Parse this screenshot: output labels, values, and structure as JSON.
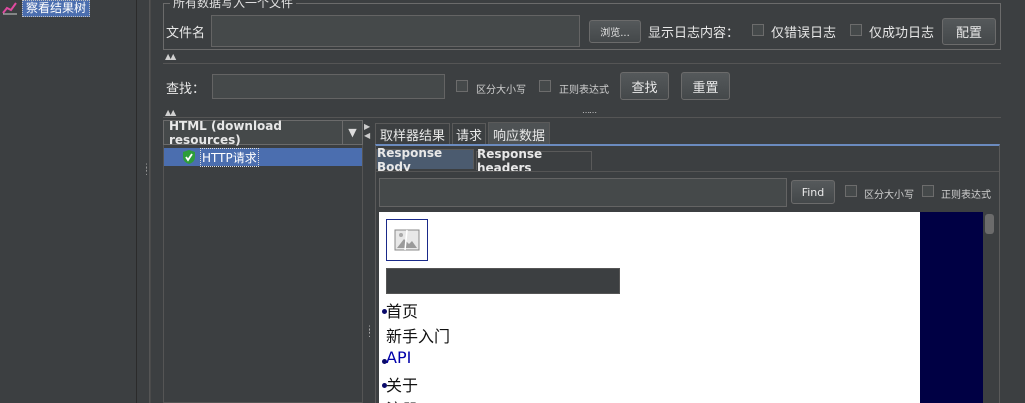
{
  "tree": {
    "selected_label": "察看结果树"
  },
  "file_section": {
    "title": "所有数据写入一个文件",
    "filename_label": "文件名",
    "filename_value": "",
    "browse_label": "浏览...",
    "log_content_label": "显示日志内容：",
    "errors_only_label": "仅错误日志",
    "success_only_label": "仅成功日志",
    "configure_label": "配置"
  },
  "search": {
    "label": "查找：",
    "value": "",
    "case_label": "区分大小写",
    "regex_label": "正则表达式",
    "find_label": "查找",
    "reset_label": "重置"
  },
  "renderer": {
    "selected": "HTML (download resources)",
    "arrow": "▼"
  },
  "results": [
    {
      "label": "HTTP请求",
      "status": "success"
    }
  ],
  "tabs": [
    "取样器结果",
    "请求",
    "响应数据"
  ],
  "active_tab": "响应数据",
  "subtabs": [
    "Response Body",
    "Response headers"
  ],
  "active_subtab": "Response Body",
  "body_search": {
    "value": "",
    "find_label": "Find",
    "case_label": "区分大小写",
    "regex_label": "正则表达式"
  },
  "html_render": {
    "nav": [
      {
        "label": "首页",
        "link": false
      },
      {
        "label": "新手入门",
        "link": false
      },
      {
        "label": "API",
        "link": true
      },
      {
        "label": "关于",
        "link": false
      },
      {
        "label": "注册",
        "link": false
      }
    ]
  },
  "colors": {
    "selection": "#4b6eaf",
    "background": "#3c3f41",
    "dark_strip": "#000044",
    "success": "#2e9d3a"
  },
  "icons": {
    "tree_item": "chart-icon",
    "result_status": "shield-check-icon",
    "broken_image": "broken-image-icon"
  }
}
